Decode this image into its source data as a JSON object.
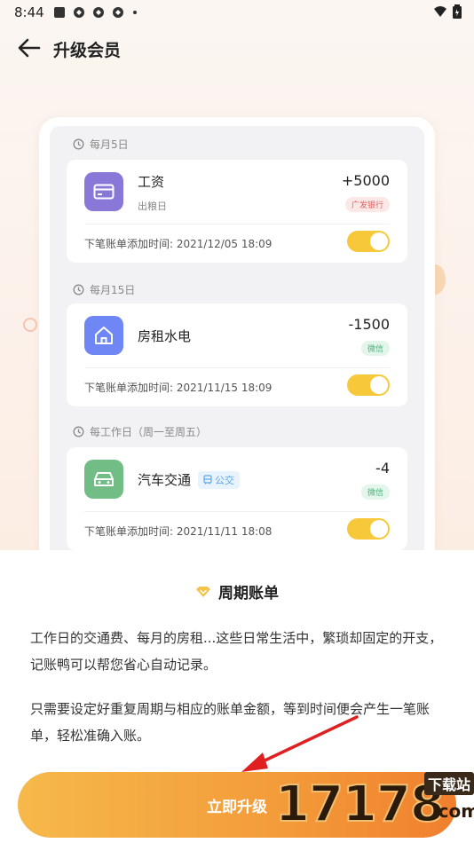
{
  "status_bar": {
    "time": "8:44"
  },
  "header": {
    "title": "升级会员"
  },
  "groups": [
    {
      "label": "每月5日"
    },
    {
      "label": "每月15日"
    },
    {
      "label": "每工作日（周一至周五）"
    }
  ],
  "cards": [
    {
      "name": "工资",
      "sub": "出粮日",
      "amount": "+5000",
      "tag": "广发银行",
      "next_label": "下笔账单添加时间:",
      "next_time": "2021/12/05 18:09",
      "icon": "credit-card-icon",
      "icon_color": "#8a78d8"
    },
    {
      "name": "房租水电",
      "amount": "-1500",
      "tag": "微信",
      "next_label": "下笔账单添加时间:",
      "next_time": "2021/11/15 18:09",
      "icon": "house-icon",
      "icon_color": "#6f86f5"
    },
    {
      "name": "汽车交通",
      "inline_tag": "公交",
      "amount": "-4",
      "tag": "微信",
      "next_label": "下笔账单添加时间:",
      "next_time": "2021/11/11 18:08",
      "icon": "car-icon",
      "icon_color": "#72bd85"
    }
  ],
  "feature": {
    "title": "周期账单",
    "para1": "工作日的交通费、每月的房租...这些日常生活中，繁琐却固定的开支，记账鸭可以帮您省心自动记录。",
    "para2": "只需要设定好重复周期与相应的账单金额，等到时间便会产生一笔账单，轻松准确入账。"
  },
  "upgrade_button": {
    "label": "立即升级"
  },
  "watermark": {
    "digits": "17178",
    "site": "下载站",
    "domain": ".com"
  },
  "colors": {
    "toggle_on": "#f7c93a",
    "button_start": "#f6b94a",
    "button_end": "#f07f2e",
    "arrow": "#e02020"
  }
}
